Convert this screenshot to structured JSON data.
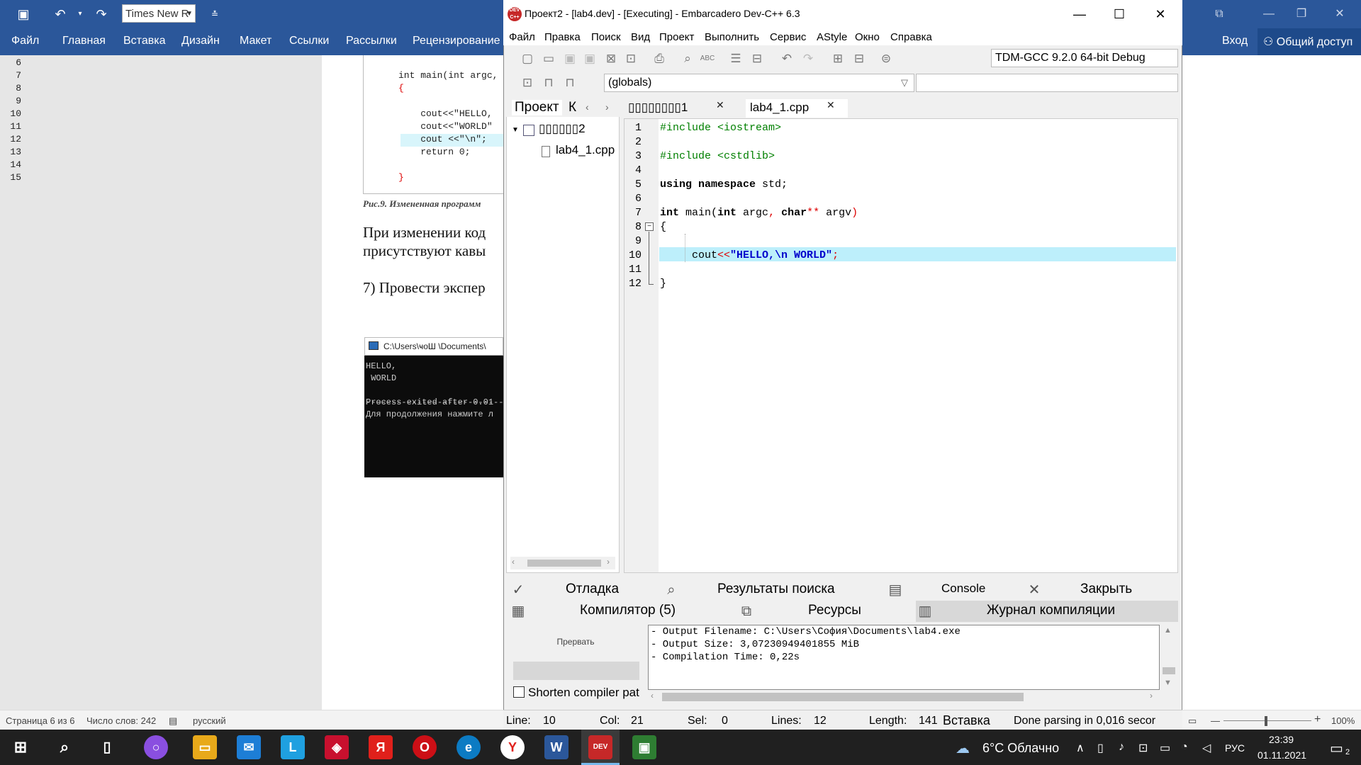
{
  "word": {
    "font_name": "Times New R",
    "ribbon_tabs": [
      "Файл",
      "Главная",
      "Вставка",
      "Дизайн",
      "Макет",
      "Ссылки",
      "Рассылки",
      "Рецензирование"
    ],
    "signin": "Вход",
    "share": "Общий доступ",
    "doc": {
      "code_lines": [
        {
          "n": "6",
          "t": ""
        },
        {
          "n": "7",
          "t": "int main(int argc,"
        },
        {
          "n": "8",
          "t": "{"
        },
        {
          "n": "9",
          "t": ""
        },
        {
          "n": "10",
          "t": "    cout<<\"HELLO,"
        },
        {
          "n": "11",
          "t": "    cout<<\"WORLD\""
        },
        {
          "n": "12",
          "t": "    cout <<\"\\n\";"
        },
        {
          "n": "13",
          "t": "    return 0;"
        },
        {
          "n": "14",
          "t": ""
        },
        {
          "n": "15",
          "t": "}"
        }
      ],
      "caption": "Рис.9. Измененная программ",
      "para1_line1": "При изменении код",
      "para1_line2": "присутствуют кавы",
      "para2": "7) Провести экспер",
      "console_title": "C:\\Users\\ҹоШ \\Documents\\",
      "console_lines": [
        "HELLO,",
        " WORLD",
        "",
        "----------------------------",
        "Process exited after 0.01",
        "Для продолжения нажмите л"
      ]
    },
    "status": {
      "page": "Страница 6 из 6",
      "words": "Число слов: 242",
      "lang": "русский",
      "zoom": "100%"
    }
  },
  "devcpp": {
    "title": "Проект2 - [lab4.dev] - [Executing] - Embarcadero Dev-C++ 6.3",
    "logo": "DEV C++",
    "menu": [
      "Файл",
      "Правка",
      "Поиск",
      "Вид",
      "Проект",
      "Выполнить",
      "Сервис",
      "AStyle",
      "Окно",
      "Справка"
    ],
    "compiler": "TDM-GCC 9.2.0 64-bit Debug",
    "globals": "(globals)",
    "left_tabs": {
      "project": "Проект",
      "classes": "К"
    },
    "tree": {
      "project": "▯▯▯▯▯▯2",
      "file": "lab4_1.cpp"
    },
    "editor_tabs": {
      "tab1": "▯▯▯▯▯▯▯▯1",
      "tab2": "lab4_1.cpp"
    },
    "code": {
      "include1": "#include <iostream>",
      "include2": "#include <cstdlib>",
      "using_kw": "using namespace",
      "using_rest": " std;",
      "main_int": "int",
      "main_fn": " main(",
      "main_int2": "int",
      "main_argc": " argc",
      "main_comma": ",",
      "main_char": " char",
      "main_stars": "**",
      "main_argv": " argv",
      "main_paren": ")",
      "brace_open": "{",
      "cout": "cout",
      "op": "<<",
      "str": "\"HELLO,\\n WORLD\"",
      "semi": ";",
      "brace_close": "}"
    },
    "line_numbers": [
      "1",
      "2",
      "3",
      "4",
      "5",
      "6",
      "7",
      "8",
      "9",
      "10",
      "11",
      "12"
    ],
    "bottom_tabs": {
      "debug": "Отладка",
      "search_results": "Результаты поиска",
      "console": "Console",
      "close": "Закрыть",
      "compiler": "Компилятор (5)",
      "resources": "Ресурсы",
      "compile_log": "Журнал компиляции"
    },
    "abort": "Прервать",
    "shorten": "Shorten compiler pat",
    "log": [
      "- Output Filename: C:\\Users\\София\\Documents\\lab4.exe",
      "- Output Size: 3,07230949401855 MiB",
      "- Compilation Time: 0,22s"
    ],
    "status": {
      "line_label": "Line:",
      "line": "10",
      "col_label": "Col:",
      "col": "21",
      "sel_label": "Sel:",
      "sel": "0",
      "lines_label": "Lines:",
      "lines": "12",
      "length_label": "Length:",
      "length": "141",
      "mode": "Вставка",
      "parse": "Done parsing in 0,016 secor"
    }
  },
  "taskbar": {
    "weather": "6°C Облачно",
    "lang": "РУС",
    "time": "23:39",
    "date": "01.11.2021",
    "notif_count": "2"
  }
}
